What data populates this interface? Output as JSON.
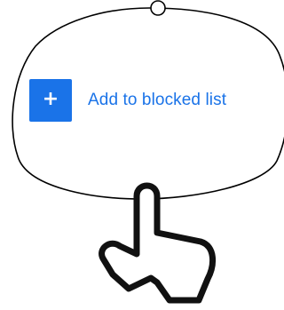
{
  "blocked_list": {
    "add_button_label": "Add to blocked list",
    "add_icon_glyph": "+",
    "icon_name": "plus-icon"
  },
  "annotation": {
    "highlight_shape": "rounded-capsule-outline",
    "pointer_icon": "hand-pointer-icon"
  },
  "colors": {
    "accent": "#1a73e8",
    "outline": "#000000",
    "background": "#ffffff"
  }
}
